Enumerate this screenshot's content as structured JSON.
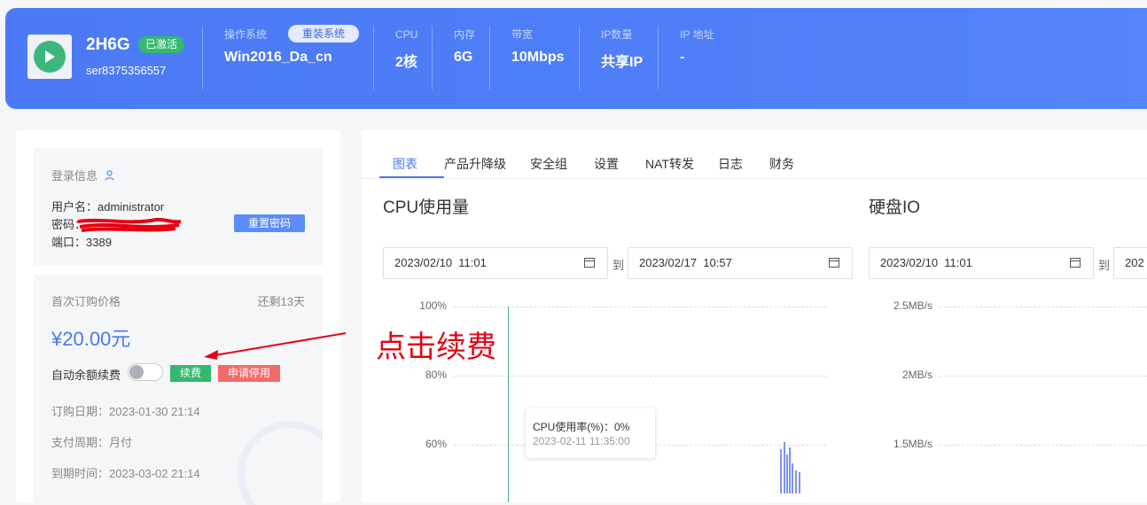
{
  "header": {
    "server_name": "2H6G",
    "status_badge": "已激活",
    "server_id": "ser8375356557",
    "os_label": "操作系统",
    "reinstall_label": "重装系统",
    "os_value": "Win2016_Da_cn",
    "cpu_label": "CPU",
    "cpu_value": "2核",
    "mem_label": "内存",
    "mem_value": "6G",
    "bw_label": "带宽",
    "bw_value": "10Mbps",
    "ipcount_label": "IP数量",
    "ipcount_value": "共享IP",
    "ip_label": "IP 地址",
    "ip_value": "-"
  },
  "login": {
    "title": "登录信息",
    "username": "用户名：administrator",
    "password": "密码：",
    "port": "端口：3389",
    "reset_label": "重置密码"
  },
  "order": {
    "first_price_label": "首次订购价格",
    "remaining": "还剩13天",
    "price": "¥20.00元",
    "auto_renew_label": "自动余额续费",
    "auto_renew_on": false,
    "renew_label": "续费",
    "stop_label": "申请停用",
    "order_date": "订购日期：2023-01-30 21:14",
    "pay_cycle": "支付周期：月付",
    "expire": "到期时间：2023-03-02 21:14"
  },
  "tabs": [
    "图表",
    "产品升降级",
    "安全组",
    "设置",
    "NAT转发",
    "日志",
    "财务"
  ],
  "cpu_chart": {
    "title": "CPU使用量",
    "start": "2023/02/10  11:01",
    "end": "2023/02/17  10:57",
    "to": "到",
    "yticks": [
      "100%",
      "80%",
      "60%"
    ],
    "tooltip_value": "CPU使用率(%)：0%",
    "tooltip_time": "2023-02-11 11:35:00"
  },
  "disk_chart": {
    "title": "硬盘IO",
    "start": "2023/02/10  11:01",
    "end": "202",
    "to": "到",
    "yticks": [
      "2.5MB/s",
      "2MB/s",
      "1.5MB/s"
    ]
  },
  "annotation": "点击续费",
  "colors": {
    "accent": "#4a78f5",
    "green": "#35b86f",
    "red": "#f26b6b",
    "annotation": "#e60012"
  }
}
